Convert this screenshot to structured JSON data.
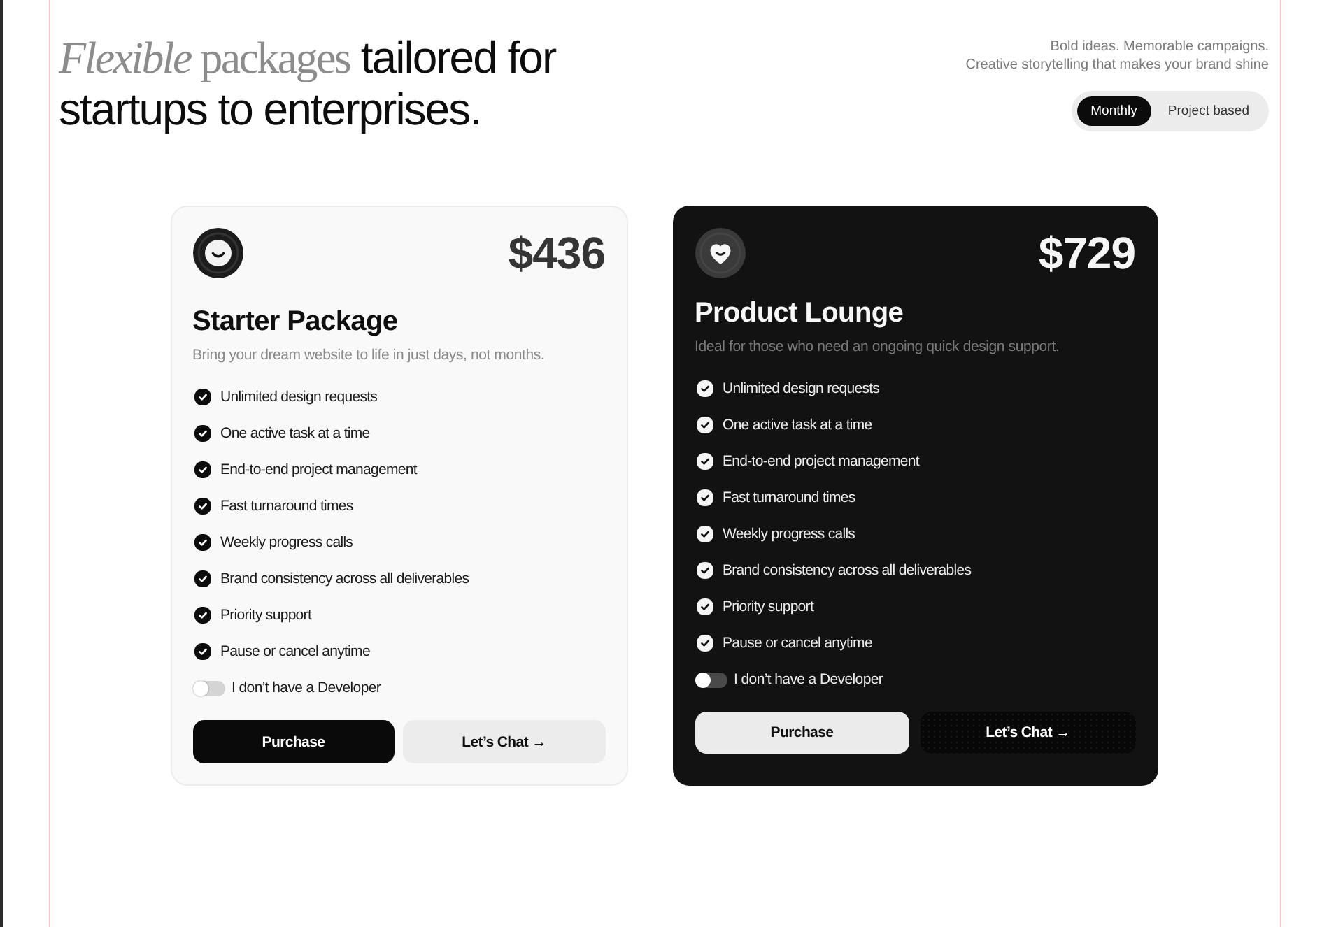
{
  "heading": {
    "accent": "*Flexible* packages",
    "text": "tailored for startups to enterprises."
  },
  "tagline": [
    "Bold ideas. Memorable campaigns.",
    "Creative storytelling that makes your brand shine"
  ],
  "billing_options": [
    {
      "label": "Monthly",
      "selected": true
    },
    {
      "label": "Project based",
      "selected": false
    }
  ],
  "cards": [
    {
      "kind": "light",
      "price": "$436",
      "title": "Starter Package",
      "description": "Bring your dream website to life in just days, not months.",
      "features": [
        "Unlimited design requests",
        "One active task at a time",
        "End-to-end project management",
        "Fast turnaround times",
        "Weekly progress calls",
        "Brand consistency across all deliverables",
        "Priority support",
        "Pause or cancel anytime"
      ],
      "developer_toggle": {
        "label": "I don’t have a Developer",
        "on": false
      },
      "buttons": [
        {
          "kind": "purchase",
          "label": "Purchase"
        },
        {
          "kind": "chat",
          "label": "Let’s Chat →"
        }
      ]
    },
    {
      "kind": "dark",
      "price": "$729",
      "title": "Product Lounge",
      "description": "Ideal for those who need an ongoing quick design support.",
      "features": [
        "Unlimited design requests",
        "One active task at a time",
        "End-to-end project management",
        "Fast turnaround times",
        "Weekly progress calls",
        "Brand consistency across all deliverables",
        "Priority support",
        "Pause or cancel anytime"
      ],
      "developer_toggle": {
        "label": "I don’t have a Developer",
        "on": false
      },
      "buttons": [
        {
          "kind": "purchase",
          "label": "Purchase"
        },
        {
          "kind": "chat",
          "label": "Let’s Chat →"
        }
      ]
    }
  ]
}
